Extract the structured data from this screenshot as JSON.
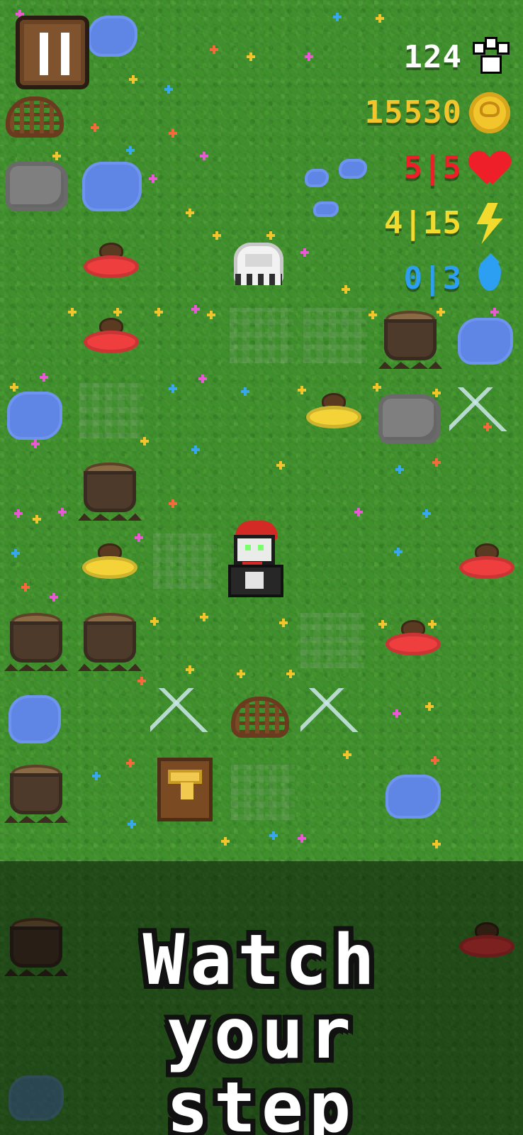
{
  "hud": {
    "steps": "124",
    "coins": "15530",
    "health": "5|5",
    "energy": "4|15",
    "water": "0|3"
  },
  "banner": {
    "text": "Watch your\nstep"
  },
  "colors": {
    "grass": "#3f8f2c",
    "steps_text": "#ffffff",
    "coins_text": "#f2c52c",
    "health_text": "#ef1f2a",
    "energy_text": "#f3da2e",
    "water_text": "#2d9ff2"
  },
  "icons": {
    "pause": "pause-icon",
    "steps": "paw-icon",
    "coins": "coin-icon",
    "health": "heart-icon",
    "energy": "lightning-icon",
    "water": "water-drop-icon"
  }
}
